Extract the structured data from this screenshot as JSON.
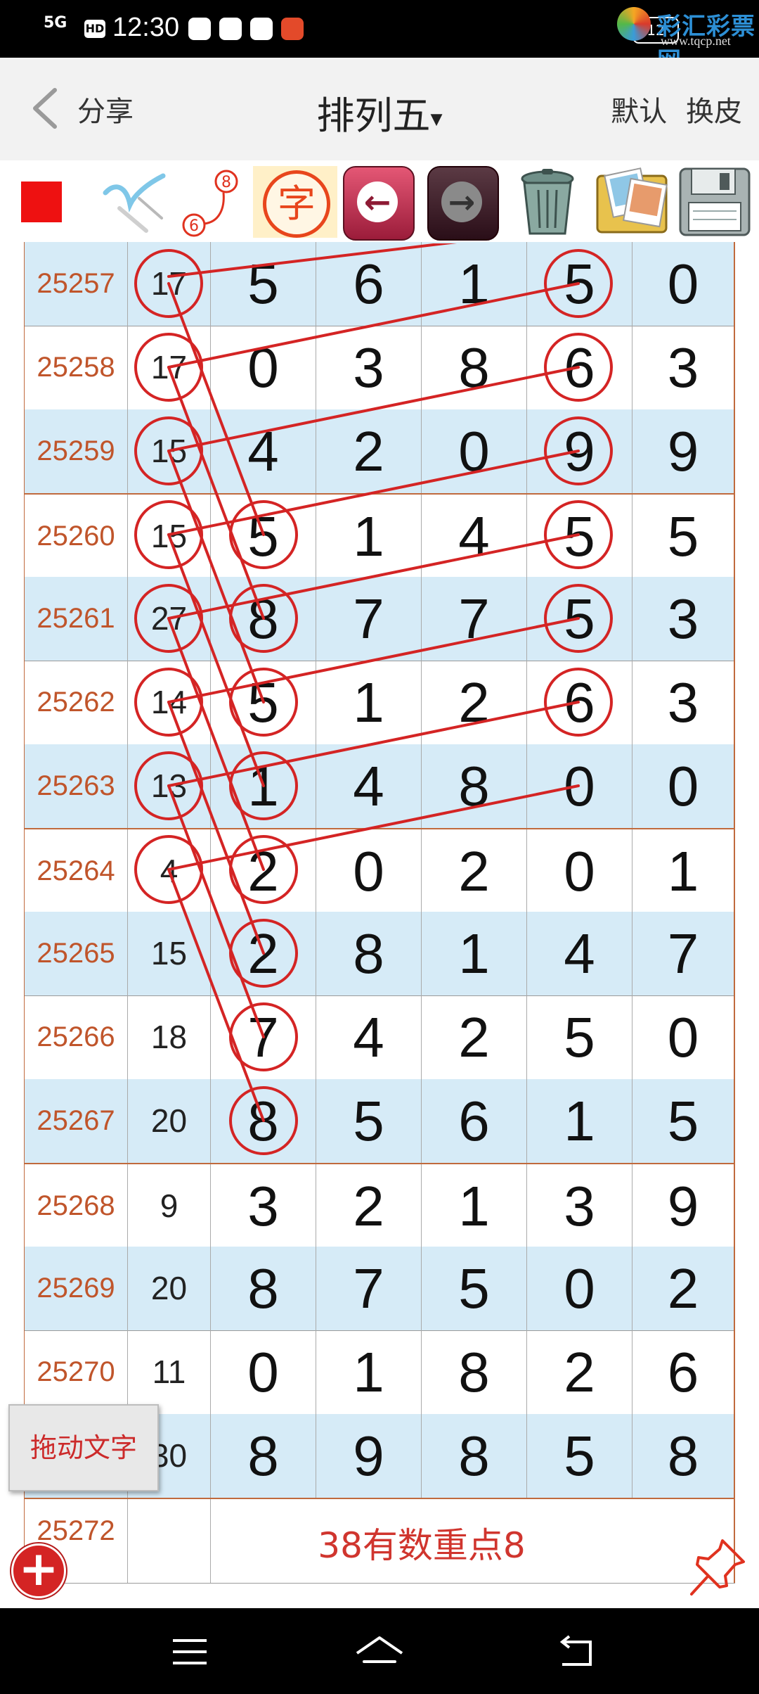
{
  "status_bar": {
    "signal": "5G",
    "hd": "HD",
    "time": "12:30",
    "battery": "12",
    "watermark": {
      "name": "彩汇彩票网",
      "url": "www.tqcp.net"
    }
  },
  "header": {
    "share": "分享",
    "title": "排列五",
    "caret": "▾",
    "default": "默认",
    "skin": "换皮"
  },
  "toolbar": {
    "char_tool": "字",
    "undo": "←",
    "redo": "→",
    "colors": {
      "pen": "#ee1111"
    }
  },
  "table": {
    "rows": [
      {
        "id": "25257",
        "sum": "17",
        "d": [
          "5",
          "6",
          "1",
          "5",
          "0"
        ]
      },
      {
        "id": "25258",
        "sum": "17",
        "d": [
          "0",
          "3",
          "8",
          "6",
          "3"
        ]
      },
      {
        "id": "25259",
        "sum": "15",
        "d": [
          "4",
          "2",
          "0",
          "9",
          "9"
        ]
      },
      {
        "id": "25260",
        "sum": "15",
        "d": [
          "5",
          "1",
          "4",
          "5",
          "5"
        ]
      },
      {
        "id": "25261",
        "sum": "27",
        "d": [
          "8",
          "7",
          "7",
          "5",
          "3"
        ]
      },
      {
        "id": "25262",
        "sum": "14",
        "d": [
          "5",
          "1",
          "2",
          "6",
          "3"
        ]
      },
      {
        "id": "25263",
        "sum": "13",
        "d": [
          "1",
          "4",
          "8",
          "0",
          "0"
        ]
      },
      {
        "id": "25264",
        "sum": "4",
        "d": [
          "2",
          "0",
          "2",
          "0",
          "1"
        ]
      },
      {
        "id": "25265",
        "sum": "15",
        "d": [
          "2",
          "8",
          "1",
          "4",
          "7"
        ]
      },
      {
        "id": "25266",
        "sum": "18",
        "d": [
          "7",
          "4",
          "2",
          "5",
          "0"
        ]
      },
      {
        "id": "25267",
        "sum": "20",
        "d": [
          "8",
          "5",
          "6",
          "1",
          "5"
        ]
      },
      {
        "id": "25268",
        "sum": "9",
        "d": [
          "3",
          "2",
          "1",
          "3",
          "9"
        ]
      },
      {
        "id": "25269",
        "sum": "20",
        "d": [
          "8",
          "7",
          "5",
          "0",
          "2"
        ]
      },
      {
        "id": "25270",
        "sum": "11",
        "d": [
          "0",
          "1",
          "8",
          "2",
          "6"
        ]
      },
      {
        "id": "",
        "sum": "30",
        "d": [
          "8",
          "9",
          "8",
          "5",
          "8"
        ]
      }
    ],
    "last_row": {
      "id": "25272",
      "note": "38有数重点8"
    }
  },
  "floating": {
    "drag_text": "拖动文字",
    "add": "+"
  },
  "annotation_color": "#d42424"
}
